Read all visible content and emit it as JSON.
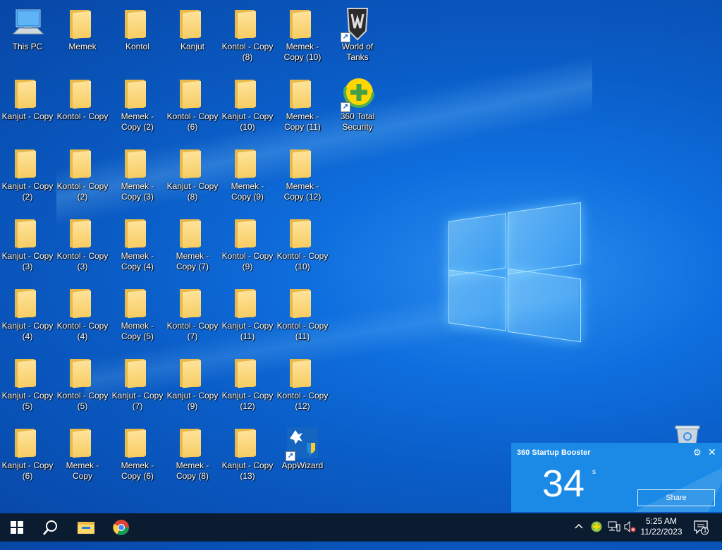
{
  "desktop": {
    "icons": [
      {
        "label": "This PC",
        "type": "pc"
      },
      {
        "label": "Memek",
        "type": "folder"
      },
      {
        "label": "Kontol",
        "type": "folder"
      },
      {
        "label": "Kanjut",
        "type": "folder"
      },
      {
        "label": "Kontol - Copy (8)",
        "type": "folder"
      },
      {
        "label": "Memek - Copy (10)",
        "type": "folder"
      },
      {
        "label": "World of Tanks",
        "type": "wot"
      },
      {
        "label": "Kanjut - Copy",
        "type": "folder"
      },
      {
        "label": "Kontol - Copy",
        "type": "folder"
      },
      {
        "label": "Memek - Copy (2)",
        "type": "folder"
      },
      {
        "label": "Kontol - Copy (6)",
        "type": "folder"
      },
      {
        "label": "Kanjut - Copy (10)",
        "type": "folder"
      },
      {
        "label": "Memek - Copy (11)",
        "type": "folder"
      },
      {
        "label": "360 Total Security",
        "type": "360"
      },
      {
        "label": "Kanjut - Copy (2)",
        "type": "folder"
      },
      {
        "label": "Kontol - Copy (2)",
        "type": "folder"
      },
      {
        "label": "Memek - Copy (3)",
        "type": "folder"
      },
      {
        "label": "Kanjut - Copy (8)",
        "type": "folder"
      },
      {
        "label": "Memek - Copy (9)",
        "type": "folder"
      },
      {
        "label": "Memek - Copy (12)",
        "type": "folder"
      },
      {
        "label": "Kanjut - Copy (3)",
        "type": "folder"
      },
      {
        "label": "Kontol - Copy (3)",
        "type": "folder"
      },
      {
        "label": "Memek - Copy (4)",
        "type": "folder"
      },
      {
        "label": "Memek - Copy (7)",
        "type": "folder"
      },
      {
        "label": "Kontol - Copy (9)",
        "type": "folder"
      },
      {
        "label": "Kontol - Copy (10)",
        "type": "folder"
      },
      {
        "label": "Kanjut - Copy (4)",
        "type": "folder"
      },
      {
        "label": "Kontol - Copy (4)",
        "type": "folder"
      },
      {
        "label": "Memek - Copy (5)",
        "type": "folder"
      },
      {
        "label": "Kontol - Copy (7)",
        "type": "folder"
      },
      {
        "label": "Kanjut - Copy (11)",
        "type": "folder"
      },
      {
        "label": "Kontol - Copy (11)",
        "type": "folder"
      },
      {
        "label": "Kanjut - Copy (5)",
        "type": "folder"
      },
      {
        "label": "Kontol - Copy (5)",
        "type": "folder"
      },
      {
        "label": "Kanjut - Copy (7)",
        "type": "folder"
      },
      {
        "label": "Kanjut - Copy (9)",
        "type": "folder"
      },
      {
        "label": "Kanjut - Copy (12)",
        "type": "folder"
      },
      {
        "label": "Kontol - Copy (12)",
        "type": "folder"
      },
      {
        "label": "Kanjut - Copy (6)",
        "type": "folder"
      },
      {
        "label": "Memek - Copy",
        "type": "folder"
      },
      {
        "label": "Memek - Copy (6)",
        "type": "folder"
      },
      {
        "label": "Memek - Copy (8)",
        "type": "folder"
      },
      {
        "label": "Kanjut - Copy (13)",
        "type": "folder"
      },
      {
        "label": "AppWizard",
        "type": "appwizard"
      }
    ]
  },
  "booster": {
    "title": "360 Startup Booster",
    "seconds": "34",
    "unit": "s",
    "share_label": "Share"
  },
  "taskbar": {
    "pinned": [
      "start-icon",
      "search-icon",
      "file-explorer-icon",
      "chrome-icon"
    ],
    "time": "5:25 AM",
    "date": "11/22/2023",
    "notification_count": "1"
  },
  "colors": {
    "taskbar": "#0b1b30",
    "booster_bg": "#1a8ae6",
    "folder": "#f7cd63"
  }
}
